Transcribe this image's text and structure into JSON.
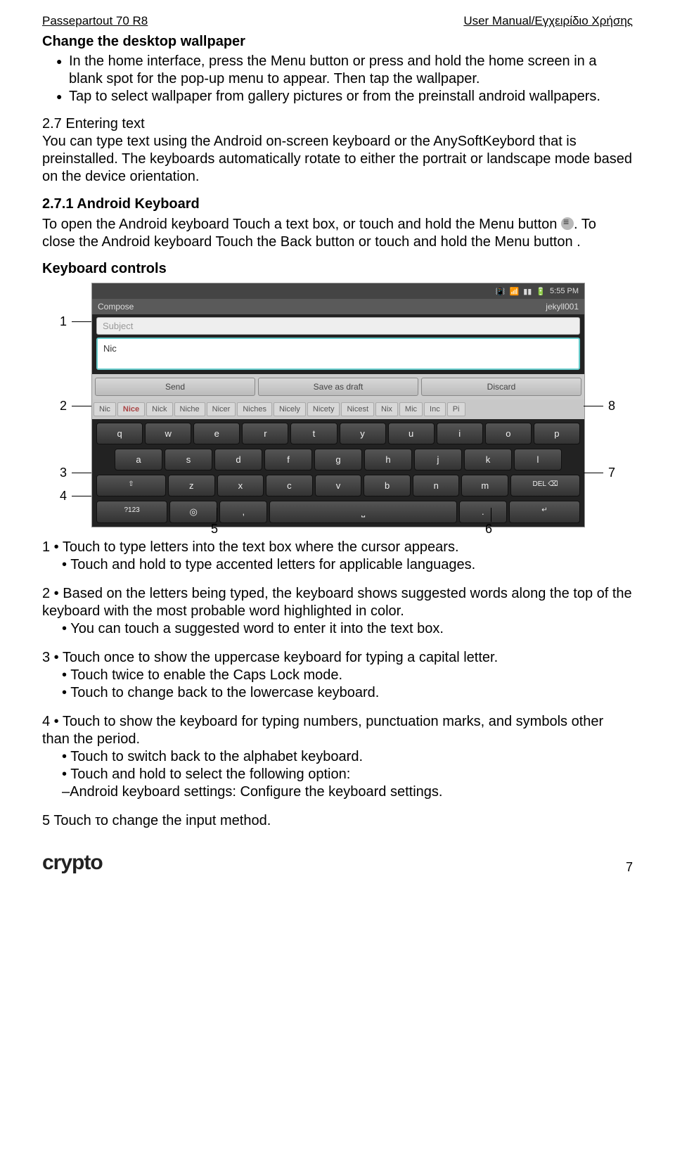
{
  "header": {
    "left": "Passepartout 70 R8",
    "right": "User Manual/Εγχειρίδιο Χρήσης"
  },
  "s1": {
    "title": "Change the desktop wallpaper",
    "b1": "In the home interface, press the Menu button or press and hold the home screen in a blank spot  for the  pop-up menu to appear. Then tap the wallpaper.",
    "b2": "Tap to select wallpaper from  gallery pictures or from the preinstall android wallpapers."
  },
  "s2": {
    "title": "2.7 Entering text",
    "p": "You can type text using the Android on-screen keyboard or the AnySoftKeybord that is preinstalled. The keyboards automatically rotate to either the portrait or landscape mode based on the device orientation."
  },
  "s3": {
    "title": "2.7.1 Android Keyboard",
    "p1a": "To open the Android keyboard Touch a text box, or touch and hold the Menu button ",
    "p1b": ". To close the Android keyboard Touch the Back button or touch and hold the Menu button .",
    "kc": "Keyboard controls"
  },
  "kb": {
    "status_time": "5:55 PM",
    "compose": "Compose",
    "account": "jekyll001",
    "subject": "Subject",
    "body": "Nic",
    "send": "Send",
    "save": "Save as draft",
    "discard": "Discard",
    "sugs": [
      "Nic",
      "Nice",
      "Nick",
      "Niche",
      "Nicer",
      "Niches",
      "Nicely",
      "Nicety",
      "Nicest",
      "Nix",
      "Mic",
      "Inc",
      "Pi"
    ],
    "r1": [
      "q",
      "w",
      "e",
      "r",
      "t",
      "y",
      "u",
      "i",
      "o",
      "p"
    ],
    "r2": [
      "a",
      "s",
      "d",
      "f",
      "g",
      "h",
      "j",
      "k",
      "l"
    ],
    "r3_shift": "⇧",
    "r3": [
      "z",
      "x",
      "c",
      "v",
      "b",
      "n",
      "m"
    ],
    "r3_del": "DEL ⌫",
    "r4_sym": "?123",
    "r4_mic": "◎",
    "r4_comma": ",",
    "r4_space": "⎵",
    "r4_period": ".",
    "r4_enter": "↵",
    "c1": "1",
    "c2": "2",
    "c3": "3",
    "c4": "4",
    "c5": "5",
    "c6": "6",
    "c7": "7",
    "c8": "8"
  },
  "notes": {
    "n1a": "1  • Touch to type letters into the text box where the cursor appears.",
    "n1b": "Touch and hold to type accented letters for applicable languages.",
    "n2a": "2  • Based on the letters being typed, the keyboard shows suggested words along the top of the keyboard with the most probable word highlighted in color.",
    "n2b": "You can touch a suggested word to enter it into the text box.",
    "n3a": "3  •  Touch once to show the uppercase keyboard for typing a capital letter.",
    "n3b": "Touch twice to enable the Caps Lock mode.",
    "n3c": "Touch to change back to the lowercase keyboard.",
    "n4a": "4  •  Touch to show the keyboard for typing numbers, punctuation marks, and symbols other than the period.",
    "n4b": "Touch to switch back to the alphabet keyboard.",
    "n4c": "Touch and hold to select the following option:",
    "n4d": "–Android keyboard settings: Configure the keyboard settings.",
    "n5": "5 Touch το change the input method."
  },
  "footer": {
    "logo": "crypto",
    "page": "7"
  }
}
